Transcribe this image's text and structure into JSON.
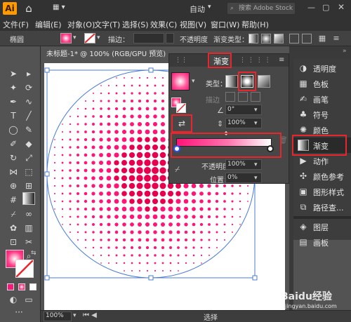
{
  "titlebar": {
    "logo": "Ai",
    "workspace": "自动",
    "search_placeholder": "搜索 Adobe Stock"
  },
  "menu": [
    "文件(F)",
    "编辑(E)",
    "对象(O)",
    "文字(T)",
    "选择(S)",
    "效果(C)",
    "视图(V)",
    "窗口(W)",
    "帮助(H)"
  ],
  "control_bar": {
    "object_label": "椭圆",
    "stroke_label": "描边：",
    "opacity_label": "不透明度",
    "gradient_type_label": "渐变类型："
  },
  "document": {
    "tab_title": "未标题-1* @ 100% (RGB/GPU 预览)",
    "close": "×"
  },
  "status": {
    "zoom": "100%",
    "mode": "选择"
  },
  "gradient_panel": {
    "tab_label": "渐变",
    "type_label": "类型：",
    "stroke_label": "描边",
    "angle_value": "0°",
    "aspect_value": "100%",
    "opacity_label": "不透明度：",
    "opacity_value": "100%",
    "position_label": "位置：",
    "position_value": "0%"
  },
  "right_panel": {
    "items": [
      {
        "label": "透明度",
        "icon": "transparency-icon"
      },
      {
        "label": "色板",
        "icon": "swatches-icon"
      },
      {
        "label": "画笔",
        "icon": "brush-icon"
      },
      {
        "label": "符号",
        "icon": "symbols-icon"
      },
      {
        "label": "颜色",
        "icon": "color-icon"
      },
      {
        "label": "渐变",
        "icon": "gradient-icon"
      },
      {
        "label": "动作",
        "icon": "play-icon"
      },
      {
        "label": "颜色参考",
        "icon": "color-guide-icon"
      },
      {
        "label": "图形样式",
        "icon": "graphic-styles-icon"
      },
      {
        "label": "路径查...",
        "icon": "pathfinder-icon"
      },
      {
        "label": "图层",
        "icon": "layers-icon"
      },
      {
        "label": "画板",
        "icon": "artboards-icon"
      }
    ]
  },
  "watermark": {
    "text": "Baidu经验",
    "sub": "jingyan.baidu.com"
  },
  "colors": {
    "accent_red": "#e8262b",
    "gradient_start": "#ffffff",
    "gradient_end": "#ff1478"
  }
}
